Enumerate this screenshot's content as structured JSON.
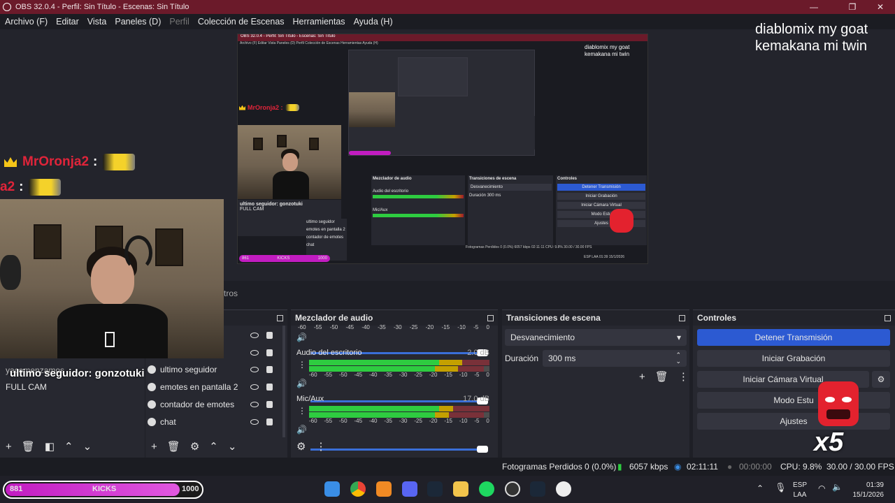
{
  "window": {
    "title": "OBS 32.0.4 - Perfil: Sin Título - Escenas: Sin Título",
    "minimize": "—",
    "maximize": "❐",
    "close": "✕"
  },
  "menu": {
    "items": [
      "Archivo (F)",
      "Editar",
      "Vista",
      "Paneles (D)",
      "Perfil",
      "Colección de Escenas",
      "Herramientas",
      "Ayuda (H)"
    ]
  },
  "overlay": {
    "top_text_line1": "diablomix my goat",
    "top_text_line2": "kemakana mi twin",
    "chat_user": "MrOronja2",
    "chat_user_partial": "a2",
    "chat_colon": ":",
    "follower_text": "ultimo seguidor: gonzotuki",
    "started_text": "yacomenzamos",
    "multiplier": "x5",
    "tab_fragment": "tros"
  },
  "nested_preview": {
    "title": "OBS 32.0.4 - Perfil: Sin Título - Escenas: Sin Título",
    "menu": "Archivo (F)   Editar   Vista   Paneles (D)   Perfil   Colección de Escenas   Herramientas   Ayuda (H)",
    "overlay_line1": "diablomix my goat",
    "overlay_line2": "kemakana mi twin",
    "chat": "MrOronja2 :",
    "mixer_title": "Mezclador de audio",
    "transitions_title": "Transiciones de escena",
    "controls_title": "Controles",
    "follower": "ultimo seguidor: gonzotuki",
    "fullcam": "FULL CAM",
    "sources": [
      "ultimo seguidor",
      "emotes en pantalla 2",
      "contador de emotes",
      "chat"
    ],
    "desktop_audio": "Audio del escritorio",
    "mic": "Mic/Aux",
    "transition": "Desvanecimiento",
    "duration_label": "Duración",
    "duration_value": "300 ms",
    "btn_stop": "Detener Transmisión",
    "btn_record": "Iniciar Grabación",
    "btn_vcam": "Iniciar Cámara Virtual",
    "btn_studio": "Modo Estu",
    "btn_settings": "Ajustes",
    "status": "Fotogramas Perdidos 0 (0.0%)   6057 kbps   02:11:11   CPU: 9.8%   30.00 / 30.00 FPS",
    "kicks_left": "861",
    "kicks_label": "KICKS",
    "kicks_right": "1000",
    "tray": "ESP LAA  01:39 15/1/2026"
  },
  "scenes": {
    "items": [
      "yacomenzamos",
      "FULL CAM"
    ]
  },
  "sources": {
    "items": [
      {
        "label": "ultimo seguidor"
      },
      {
        "label": "emotes en pantalla 2"
      },
      {
        "label": "contador de emotes"
      },
      {
        "label": "chat"
      }
    ]
  },
  "mixer": {
    "title": "Mezclador de audio",
    "scale": [
      "-60",
      "-55",
      "-50",
      "-45",
      "-40",
      "-35",
      "-30",
      "-25",
      "-20",
      "-15",
      "-10",
      "-5",
      "0"
    ],
    "channels": [
      {
        "name": "Audio del escritorio",
        "db": "2.0 dB",
        "level": 0.85
      },
      {
        "name": "Mic/Aux",
        "db": "17.0 dB",
        "level": 0.8
      }
    ]
  },
  "transitions": {
    "title": "Transiciones de escena",
    "selected": "Desvanecimiento",
    "duration_label": "Duración",
    "duration_value": "300 ms"
  },
  "controls": {
    "title": "Controles",
    "stop_stream": "Detener Transmisión",
    "start_recording": "Iniciar Grabación",
    "start_virtual_cam": "Iniciar Cámara Virtual",
    "studio_mode": "Modo Estu",
    "settings": "Ajustes"
  },
  "status": {
    "dropped_frames": "Fotogramas Perdidos 0 (0.0%)",
    "bitrate": "6057 kbps",
    "stream_time": "02:11:11",
    "record_time": "00:00:00",
    "cpu": "CPU: 9.8%",
    "fps": "30.00 / 30.00 FPS"
  },
  "kicks": {
    "left": "881",
    "label": "KICKS",
    "right": "1000",
    "progress": 0.881
  },
  "tray": {
    "lang1": "ESP",
    "lang2": "LAA",
    "time": "01:39",
    "date": "15/1/2026"
  },
  "colors": {
    "titlebar": "#6b1a2a",
    "primary_button": "#2c5ad2",
    "meter_green": "#2ecc40",
    "meter_yellow": "#c4a000",
    "meter_red": "#9e1b2a",
    "kicks_bar": "#c21cc1",
    "chat_name": "#e0243a"
  }
}
